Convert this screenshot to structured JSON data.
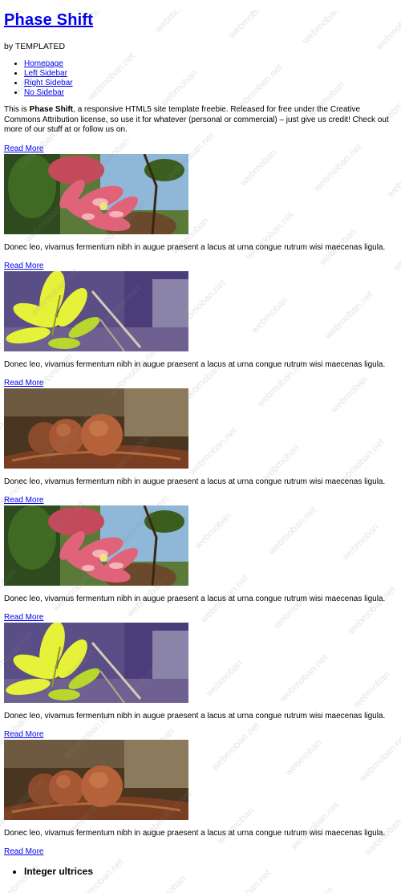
{
  "site": {
    "title": "Phase Shift",
    "byline": "by TEMPLATED"
  },
  "nav": [
    {
      "label": "Homepage"
    },
    {
      "label": "Left Sidebar"
    },
    {
      "label": "Right Sidebar"
    },
    {
      "label": "No Sidebar"
    }
  ],
  "intro": {
    "prefix": "This is ",
    "bold": "Phase Shift",
    "suffix": ", a responsive HTML5 site template freebie. Released for free under the Creative Commons Attribution license, so use it for whatever (personal or commercial) – just give us credit! Check out more of our stuff at or follow us on."
  },
  "read_more_label": "Read More",
  "posts": [
    {
      "image": "pink-flower",
      "text": "Donec leo, vivamus fermentum nibh in augue praesent a lacus at urna congue rutrum wisi maecenas ligula."
    },
    {
      "image": "yellow-leaves",
      "text": "Donec leo, vivamus fermentum nibh in augue praesent a lacus at urna congue rutrum wisi maecenas ligula."
    },
    {
      "image": "brown-seeds",
      "text": "Donec leo, vivamus fermentum nibh in augue praesent a lacus at urna congue rutrum wisi maecenas ligula."
    },
    {
      "image": "pink-flower",
      "text": "Donec leo, vivamus fermentum nibh in augue praesent a lacus at urna congue rutrum wisi maecenas ligula."
    },
    {
      "image": "yellow-leaves",
      "text": "Donec leo, vivamus fermentum nibh in augue praesent a lacus at urna congue rutrum wisi maecenas ligula."
    },
    {
      "image": "brown-seeds",
      "text": "Donec leo, vivamus fermentum nibh in augue praesent a lacus at urna congue rutrum wisi maecenas ligula."
    }
  ],
  "bottom_list": [
    {
      "label": "Integer ultrices"
    }
  ],
  "watermark": "webmoban.net",
  "colors": {
    "link": "#0000ee",
    "text": "#000000",
    "background": "#ffffff"
  }
}
